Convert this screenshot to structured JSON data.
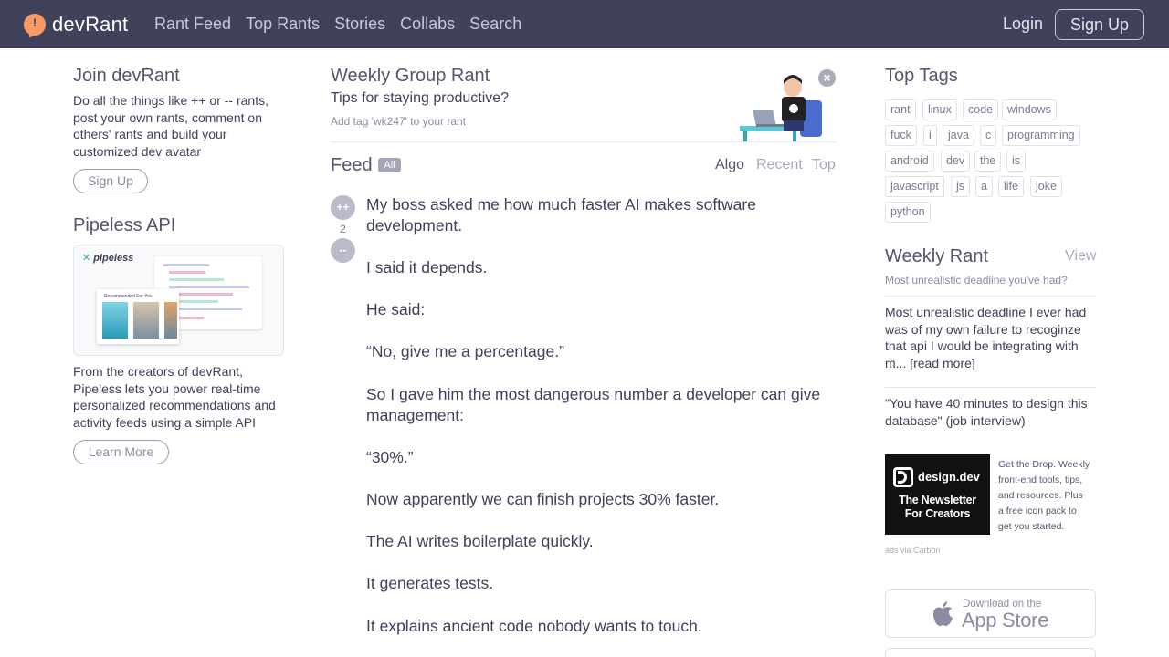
{
  "header": {
    "logo_text": "devRant",
    "nav": [
      "Rant Feed",
      "Top Rants",
      "Stories",
      "Collabs",
      "Search"
    ],
    "login_label": "Login",
    "signup_label": "Sign Up"
  },
  "left": {
    "join_title": "Join devRant",
    "join_text": [
      "Do all the things like ++ or -- rants,",
      "post your own rants, comment on",
      "others' rants and build your",
      "customized dev avatar"
    ],
    "join_button": "Sign Up",
    "pipeless_title": "Pipeless API",
    "pipeless_logo": "pipeless",
    "pipeless_card_heading": "Recommended For You",
    "pipeless_text": [
      "From the creators of devRant,",
      "Pipeless lets you power real-time",
      "personalized recommendations and",
      "activity feeds using a simple API"
    ],
    "learn_more": "Learn More"
  },
  "weekly_group": {
    "title": "Weekly Group Rant",
    "subtitle": "Tips for staying productive?",
    "tag_hint": "Add tag 'wk247' to your rant",
    "close_label": "×"
  },
  "feed": {
    "title": "Feed",
    "filter_badge": "All",
    "sort": [
      "Algo",
      "Recent",
      "Top"
    ],
    "active_sort": "Algo"
  },
  "rant": {
    "upvote": "++",
    "score": "2",
    "downvote": "--",
    "lines": [
      "My boss asked me how much faster AI makes software",
      "development.",
      "I said it depends.",
      "He said:",
      "“No, give me a percentage.”",
      "So I gave him the most dangerous number a developer can give",
      "management:",
      "“30%.”",
      "Now apparently we can finish projects 30% faster.",
      "The AI writes boilerplate quickly.",
      "It generates tests.",
      "It explains ancient code nobody wants to touch."
    ]
  },
  "right": {
    "top_tags_title": "Top Tags",
    "tags": [
      "rant",
      "linux",
      "code",
      "windows",
      "fuck",
      "i",
      "java",
      "c",
      "programming",
      "android",
      "dev",
      "the",
      "is",
      "javascript",
      "js",
      "a",
      "life",
      "joke",
      "python"
    ],
    "weekly_title": "Weekly Rant",
    "weekly_view": "View",
    "weekly_question": "Most unrealistic deadline you've had?",
    "weekly_post1": [
      "Most unrealistic deadline I ever had",
      "was of my own failure to recoginze",
      "that api I would be integrating with",
      "m... [read more]"
    ],
    "weekly_post2": [
      "\"You have 40 minutes to design this",
      "database\" (job interview)"
    ],
    "ad_brand": "design.dev",
    "ad_line1": "The Newsletter",
    "ad_line2": "For Creators",
    "ad_text": [
      "Get the Drop. Weekly",
      "front-end tools, tips,",
      "and resources. Plus",
      "a free icon pack to",
      "get you started."
    ],
    "ad_via": "ads via Carbon",
    "appstore_small": "Download on the",
    "appstore_big": "App Store"
  },
  "colors": {
    "header_bg": "#40415a",
    "logo_accent": "#f99a66",
    "vote_bg": "#babbc9"
  }
}
